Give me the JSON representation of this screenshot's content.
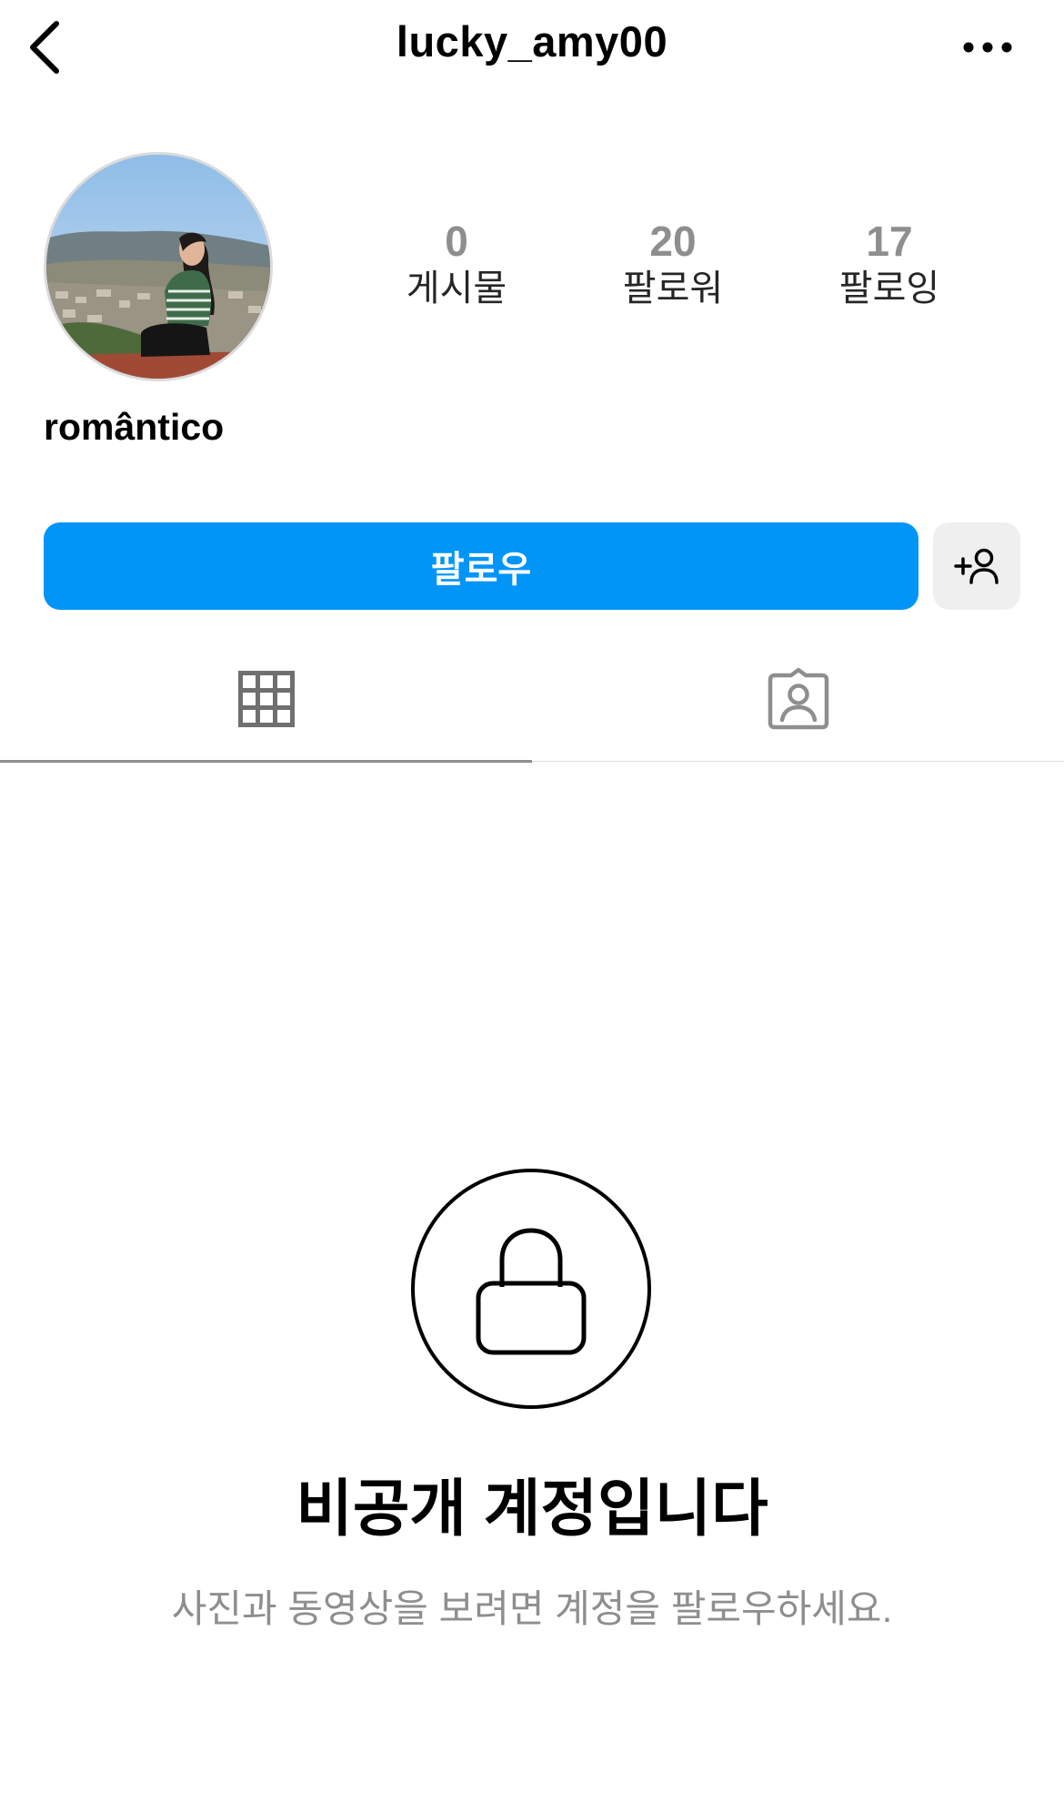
{
  "header": {
    "username": "lucky_amy00",
    "back_icon": "chevron-left-icon",
    "more_icon": "more-horizontal-icon"
  },
  "profile": {
    "display_name": "romântico",
    "stats": [
      {
        "count": "0",
        "label": "게시물"
      },
      {
        "count": "20",
        "label": "팔로워"
      },
      {
        "count": "17",
        "label": "팔로잉"
      }
    ]
  },
  "actions": {
    "follow_label": "팔로우",
    "follow_color": "#0095f6",
    "suggest_icon": "add-person-icon"
  },
  "tabs": [
    {
      "icon": "grid-icon",
      "active": true
    },
    {
      "icon": "tagged-person-icon",
      "active": false
    }
  ],
  "private_account": {
    "icon": "lock-icon",
    "title": "비공개 계정입니다",
    "subtitle": "사진과 동영상을 보려면 계정을 팔로우하세요."
  }
}
